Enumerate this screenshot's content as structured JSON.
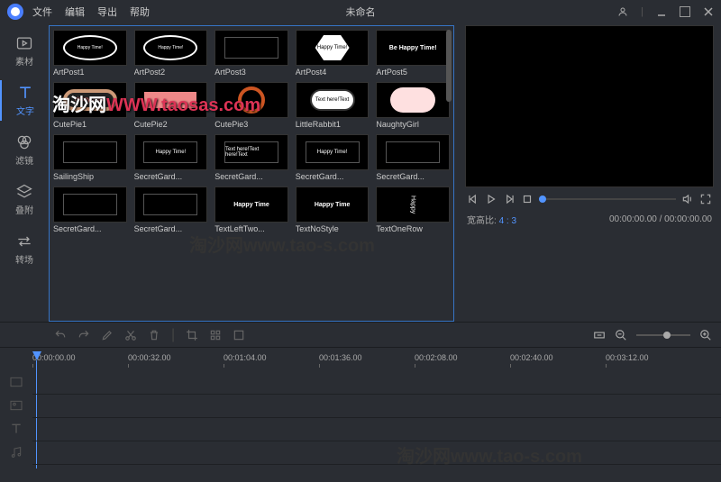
{
  "titlebar": {
    "menu": [
      "文件",
      "编辑",
      "导出",
      "帮助"
    ],
    "title": "未命名"
  },
  "sidebar": {
    "items": [
      {
        "label": "素材",
        "icon": "play-box-icon"
      },
      {
        "label": "文字",
        "icon": "text-icon"
      },
      {
        "label": "滤镜",
        "icon": "circles-icon"
      },
      {
        "label": "叠附",
        "icon": "layers-icon"
      },
      {
        "label": "转场",
        "icon": "arrows-icon"
      }
    ]
  },
  "grid": {
    "items": [
      {
        "label": "ArtPost1",
        "style": "ellipse",
        "text": "Happy Time!"
      },
      {
        "label": "ArtPost2",
        "style": "ellipse",
        "text": "Happy Time!"
      },
      {
        "label": "ArtPost3",
        "style": "dark",
        "text": ""
      },
      {
        "label": "ArtPost4",
        "style": "hex",
        "text": "Happy Time!"
      },
      {
        "label": "ArtPost5",
        "style": "plain",
        "text": "Be Happy Time!"
      },
      {
        "label": "CutePie1",
        "style": "pink",
        "text": "Happy Time!"
      },
      {
        "label": "CutePie2",
        "style": "ribbon",
        "text": ""
      },
      {
        "label": "CutePie3",
        "style": "badge",
        "text": ""
      },
      {
        "label": "LittleRabbit1",
        "style": "bubble",
        "text": "Text here!Text"
      },
      {
        "label": "NaughtyGirl",
        "style": "cloud",
        "text": ""
      },
      {
        "label": "SailingShip",
        "style": "dark",
        "text": ""
      },
      {
        "label": "SecretGard...",
        "style": "dark",
        "text": "Happy Time!"
      },
      {
        "label": "SecretGard...",
        "style": "dark",
        "text": "Text here!Text here!Text"
      },
      {
        "label": "SecretGard...",
        "style": "dark",
        "text": "Happy Time!"
      },
      {
        "label": "SecretGard...",
        "style": "dark",
        "text": ""
      },
      {
        "label": "SecretGard...",
        "style": "dark",
        "text": ""
      },
      {
        "label": "SecretGard...",
        "style": "dark",
        "text": ""
      },
      {
        "label": "TextLeftTwo...",
        "style": "plain",
        "text": "Happy Time"
      },
      {
        "label": "TextNoStyle",
        "style": "plain",
        "text": "Happy Time"
      },
      {
        "label": "TextOneRow",
        "style": "vert",
        "text": "Happy"
      }
    ]
  },
  "preview": {
    "aspect_label": "宽高比:",
    "aspect_value": "4 : 3",
    "time": "00:00:00.00 / 00:00:00.00"
  },
  "ruler": {
    "marks": [
      "00:00:00.00",
      "00:00:32.00",
      "00:01:04.00",
      "00:01:36.00",
      "00:02:08.00",
      "00:02:40.00",
      "00:03:12.00"
    ]
  },
  "watermarks": {
    "w1_zh": "淘沙网",
    "w1_en": "WWW.taosas.com",
    "w2": "淘沙网www.tao-s.com",
    "w3": "淘沙网www.tao-s.com"
  }
}
